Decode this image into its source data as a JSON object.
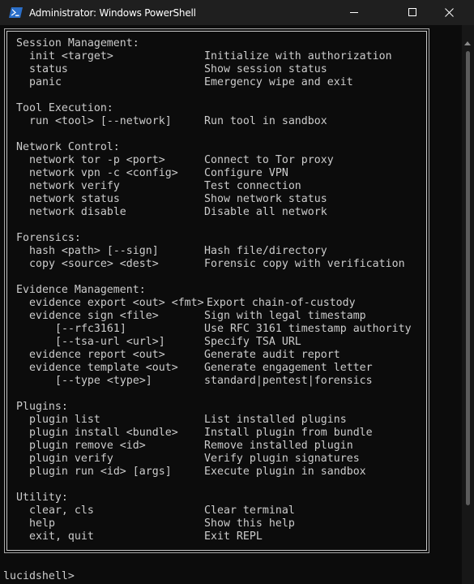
{
  "window": {
    "title": "Administrator: Windows PowerShell",
    "icon": "powershell-icon",
    "controls": [
      "minimize-icon",
      "maximize-icon",
      "close-icon"
    ],
    "colors": {
      "titlebar": "#1f1f1f",
      "background": "#0c0c0c",
      "text": "#cccccc"
    }
  },
  "help": {
    "sections": [
      {
        "heading": "Session Management:",
        "commands": [
          {
            "cmd": "init <target>",
            "desc": "Initialize with authorization"
          },
          {
            "cmd": "status",
            "desc": "Show session status"
          },
          {
            "cmd": "panic",
            "desc": "Emergency wipe and exit"
          }
        ]
      },
      {
        "heading": "Tool Execution:",
        "commands": [
          {
            "cmd": "run <tool> [--network]",
            "desc": "Run tool in sandbox"
          }
        ]
      },
      {
        "heading": "Network Control:",
        "commands": [
          {
            "cmd": "network tor -p <port>",
            "desc": "Connect to Tor proxy"
          },
          {
            "cmd": "network vpn -c <config>",
            "desc": "Configure VPN"
          },
          {
            "cmd": "network verify",
            "desc": "Test connection"
          },
          {
            "cmd": "network status",
            "desc": "Show network status"
          },
          {
            "cmd": "network disable",
            "desc": "Disable all network"
          }
        ]
      },
      {
        "heading": "Forensics:",
        "commands": [
          {
            "cmd": "hash <path> [--sign]",
            "desc": "Hash file/directory"
          },
          {
            "cmd": "copy <source> <dest>",
            "desc": "Forensic copy with verification"
          }
        ]
      },
      {
        "heading": "Evidence Management:",
        "commands": [
          {
            "cmd": "evidence export <out> <fmt>",
            "desc": "Export chain-of-custody",
            "inline": true
          },
          {
            "cmd": "evidence sign <file>",
            "desc": "Sign with legal timestamp"
          },
          {
            "cmd": "[--rfc3161]",
            "desc": "Use RFC 3161 timestamp authority",
            "nested": true
          },
          {
            "cmd": "[--tsa-url <url>]",
            "desc": "Specify TSA URL",
            "nested": true
          },
          {
            "cmd": "evidence report <out>",
            "desc": "Generate audit report"
          },
          {
            "cmd": "evidence template <out>",
            "desc": "Generate engagement letter"
          },
          {
            "cmd": "[--type <type>]",
            "desc": "standard|pentest|forensics",
            "nested": true
          }
        ]
      },
      {
        "heading": "Plugins:",
        "commands": [
          {
            "cmd": "plugin list",
            "desc": "List installed plugins"
          },
          {
            "cmd": "plugin install <bundle>",
            "desc": "Install plugin from bundle"
          },
          {
            "cmd": "plugin remove <id>",
            "desc": "Remove installed plugin"
          },
          {
            "cmd": "plugin verify",
            "desc": "Verify plugin signatures"
          },
          {
            "cmd": "plugin run <id> [args]",
            "desc": "Execute plugin in sandbox"
          }
        ]
      },
      {
        "heading": "Utility:",
        "commands": [
          {
            "cmd": "clear, cls",
            "desc": "Clear terminal"
          },
          {
            "cmd": "help",
            "desc": "Show this help"
          },
          {
            "cmd": "exit, quit",
            "desc": "Exit REPL"
          }
        ]
      }
    ]
  },
  "prompt": {
    "text": "lucidshell>",
    "input_value": ""
  }
}
